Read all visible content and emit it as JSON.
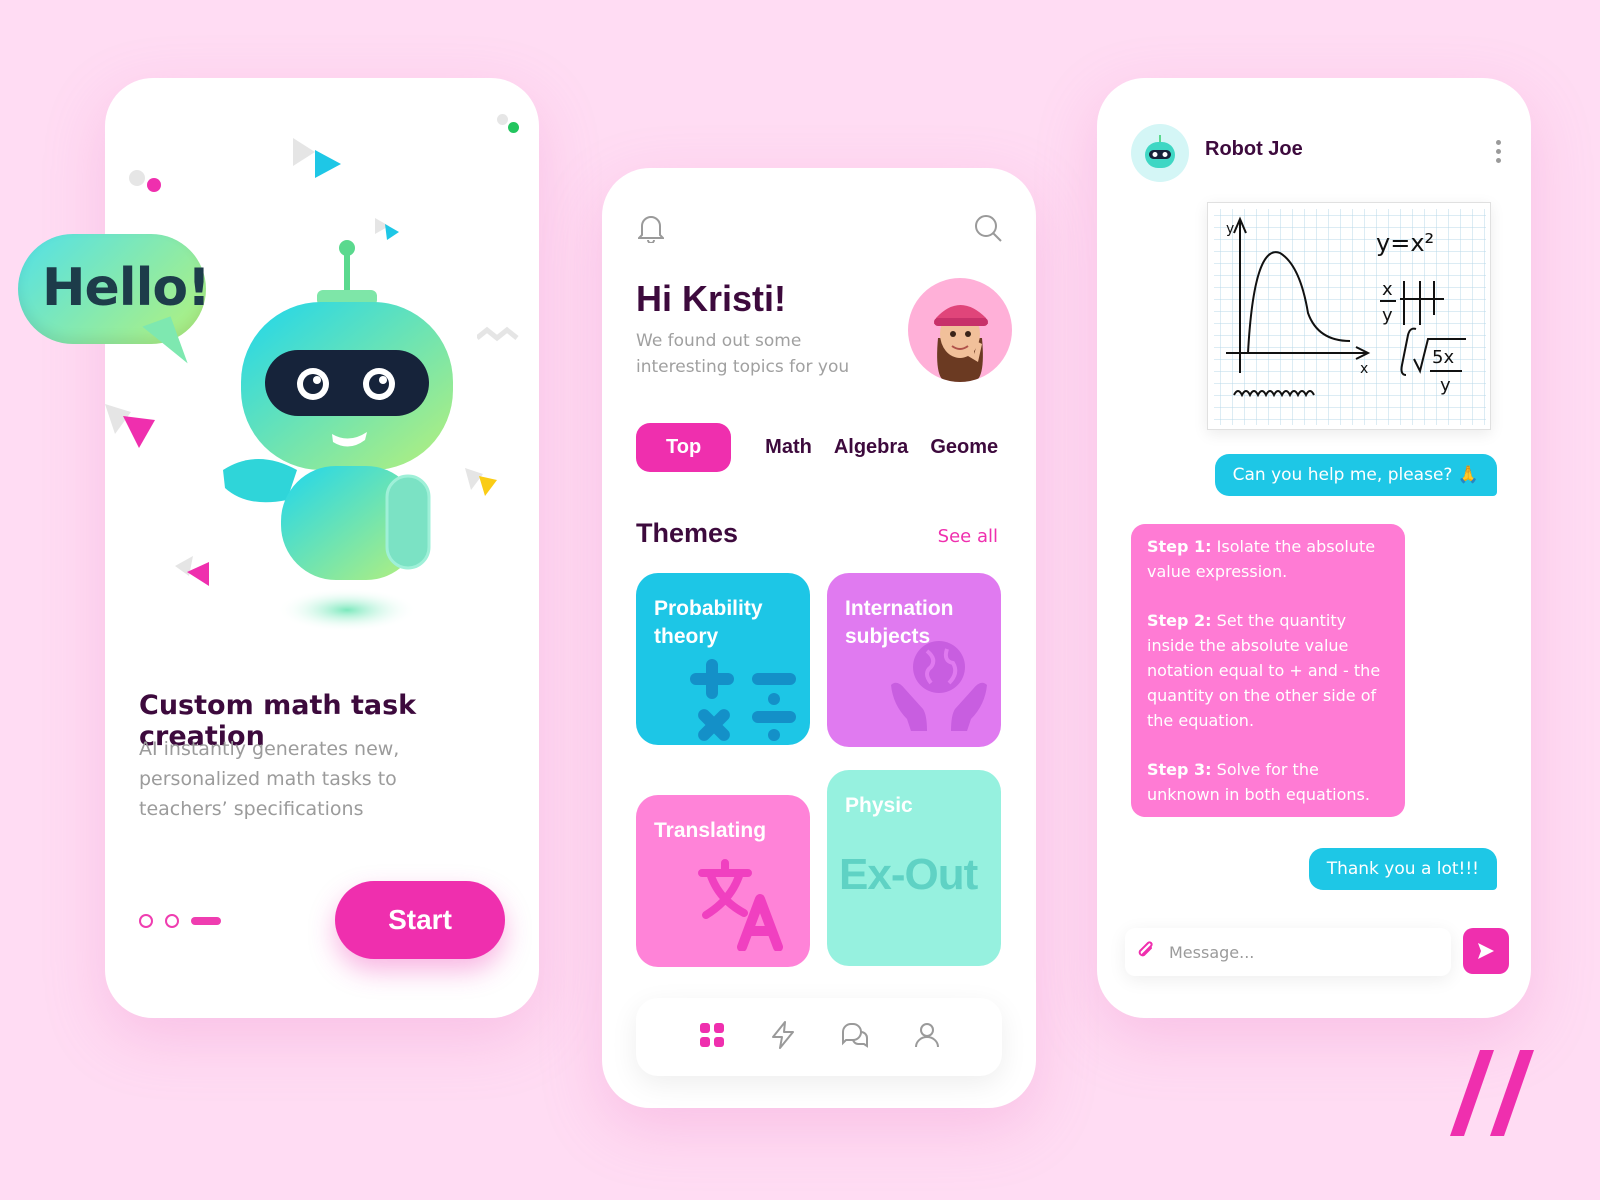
{
  "onboarding": {
    "bubble_text": "Hello!",
    "title": "Custom math task creation",
    "description": "AI instantly generates new, personalized math tasks to teachers’ specifications",
    "start_label": "Start",
    "pager": {
      "total": 3,
      "active": 3
    }
  },
  "home": {
    "greeting": "Hi Kristi!",
    "subtitle": "We found out some interesting topics for you",
    "tabs": [
      {
        "label": "Top",
        "active": true
      },
      {
        "label": "Math",
        "active": false
      },
      {
        "label": "Algebra",
        "active": false
      },
      {
        "label": "Geome",
        "active": false
      }
    ],
    "themes_heading": "Themes",
    "see_all": "See all",
    "cards": [
      {
        "title": "Probability theory",
        "color": "#1dc6e6"
      },
      {
        "title": "Internation subjects",
        "color": "#e07af0"
      },
      {
        "title": "Translating",
        "color": "#ff83d8"
      },
      {
        "title": "Physic",
        "color": "#96f1df",
        "watermark": "Ex-Out"
      }
    ],
    "nav": [
      "grid-icon",
      "lightning-icon",
      "chat-icon",
      "user-icon"
    ]
  },
  "chat": {
    "bot_name": "Robot Joe",
    "graph_labels": {
      "y": "y",
      "x": "x",
      "eq1": "y=x²",
      "frac_top": "x",
      "frac_bottom": "y",
      "root": "5x",
      "root_bottom": "y"
    },
    "messages": {
      "user_1": "Can you help me, please? 🙏",
      "step1_label": "Step 1:",
      "step1_text": " Isolate the absolute value expression.",
      "step2_label": "Step 2:",
      "step2_text": " Set the quantity inside the absolute value notation equal to + and - the quantity on the other side of the equation.",
      "step3_label": "Step 3:",
      "step3_text": " Solve for the unknown in both equations.",
      "user_2": "Thank you a lot!!!"
    },
    "input_placeholder": "Message..."
  },
  "colors": {
    "accent": "#ef2fae",
    "cyan": "#1ec7e6",
    "background": "#ffdcf3",
    "text": "#3d0a3d"
  }
}
